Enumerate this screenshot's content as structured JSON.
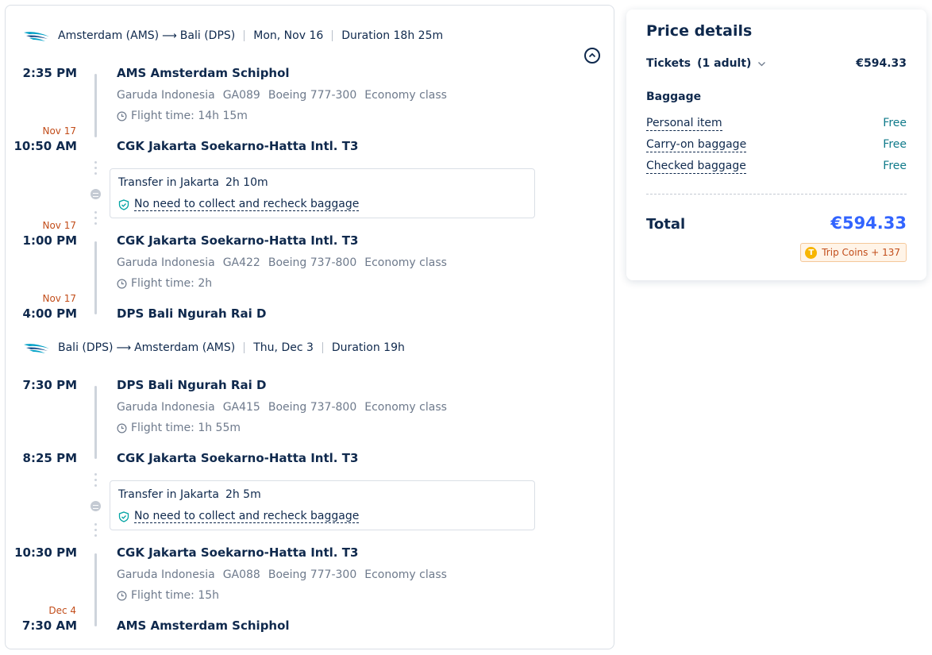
{
  "outbound": {
    "header": {
      "from": "Amsterdam (AMS)",
      "to": "Bali (DPS)",
      "date": "Mon, Nov 16",
      "duration": "Duration 18h 25m"
    },
    "seg1": {
      "dep_time": "2:35 PM",
      "dep_airport": "AMS Amsterdam Schiphol",
      "airline": "Garuda Indonesia",
      "flight_no": "GA089",
      "aircraft": "Boeing 777-300",
      "cabin": "Economy class",
      "flight_time": "Flight time: 14h 15m",
      "arr_day": "Nov 17",
      "arr_time": "10:50 AM",
      "arr_airport": "CGK Jakarta Soekarno-Hatta Intl. T3"
    },
    "transfer": {
      "title": "Transfer in Jakarta",
      "duration": "2h 10m",
      "note": "No need to collect and recheck baggage"
    },
    "seg2": {
      "dep_day": "Nov 17",
      "dep_time": "1:00 PM",
      "dep_airport": "CGK Jakarta Soekarno-Hatta Intl. T3",
      "airline": "Garuda Indonesia",
      "flight_no": "GA422",
      "aircraft": "Boeing 737-800",
      "cabin": "Economy class",
      "flight_time": "Flight time: 2h",
      "arr_day": "Nov 17",
      "arr_time": "4:00 PM",
      "arr_airport": "DPS Bali Ngurah Rai D"
    }
  },
  "return": {
    "header": {
      "from": "Bali (DPS)",
      "to": "Amsterdam (AMS)",
      "date": "Thu, Dec 3",
      "duration": "Duration 19h"
    },
    "seg1": {
      "dep_time": "7:30 PM",
      "dep_airport": "DPS Bali Ngurah Rai D",
      "airline": "Garuda Indonesia",
      "flight_no": "GA415",
      "aircraft": "Boeing 737-800",
      "cabin": "Economy class",
      "flight_time": "Flight time: 1h 55m",
      "arr_time": "8:25 PM",
      "arr_airport": "CGK Jakarta Soekarno-Hatta Intl. T3"
    },
    "transfer": {
      "title": "Transfer in Jakarta",
      "duration": "2h 5m",
      "note": "No need to collect and recheck baggage"
    },
    "seg2": {
      "dep_time": "10:30 PM",
      "dep_airport": "CGK Jakarta Soekarno-Hatta Intl. T3",
      "airline": "Garuda Indonesia",
      "flight_no": "GA088",
      "aircraft": "Boeing 777-300",
      "cabin": "Economy class",
      "flight_time": "Flight time: 15h",
      "arr_day": "Dec 4",
      "arr_time": "7:30 AM",
      "arr_airport": "AMS Amsterdam Schiphol"
    }
  },
  "price": {
    "title": "Price details",
    "tickets_label": "Tickets",
    "tickets_count": "(1 adult)",
    "tickets_price": "€594.33",
    "baggage_heading": "Baggage",
    "baggage": [
      {
        "label": "Personal item",
        "value": "Free"
      },
      {
        "label": "Carry-on baggage",
        "value": "Free"
      },
      {
        "label": "Checked baggage",
        "value": "Free"
      }
    ],
    "total_label": "Total",
    "total_price": "€594.33",
    "coins": "Trip Coins + 137",
    "coin_letter": "T"
  },
  "icons": {
    "airline_logo": "garuda-logo-icon",
    "arrow": "long-arrow-right-icon",
    "clock": "clock-icon",
    "shield": "shield-check-icon",
    "collapse": "chevron-up-circle-icon",
    "transfer": "transfer-dot-icon",
    "dropdown": "chevron-down-icon",
    "coin": "trip-coin-icon"
  },
  "colors": {
    "text": "#0f294d",
    "muted": "#6e7a8c",
    "day_change": "#c24d1a",
    "free": "#0f7a8a",
    "total": "#3264ff",
    "shield": "#00a3a3"
  }
}
